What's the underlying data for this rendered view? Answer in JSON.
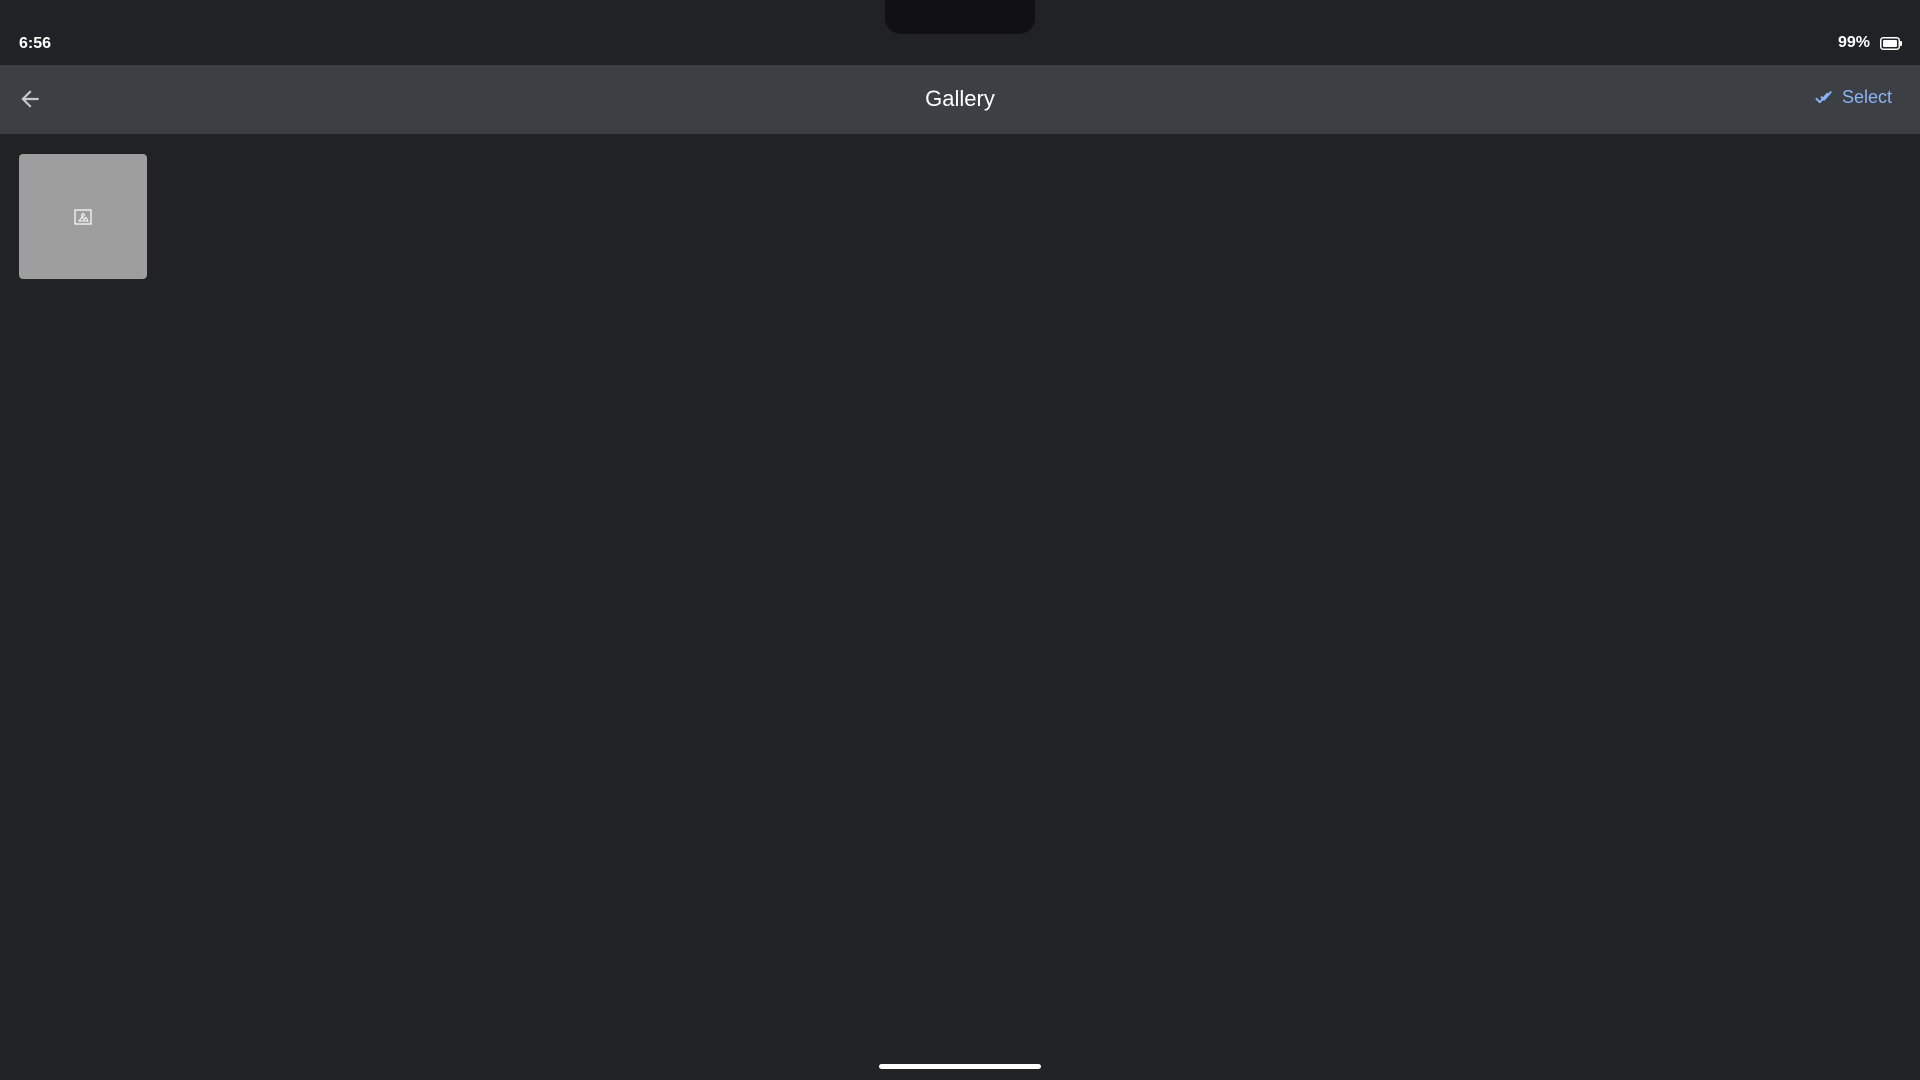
{
  "status_bar": {
    "time": "6:56",
    "battery_percent": "99%",
    "battery_icon": "battery-icon"
  },
  "app_bar": {
    "title": "Gallery",
    "back_icon": "arrow-back-icon",
    "select_label": "Select",
    "select_icon": "double-check-icon",
    "accent_color": "#8ab4f8"
  },
  "gallery": {
    "items": [
      {
        "type": "image",
        "icon": "broken-image-icon",
        "placeholder_color": "#9e9e9e"
      }
    ]
  },
  "colors": {
    "background": "#212226",
    "app_bar": "#3c3f43",
    "text": "#ffffff"
  }
}
